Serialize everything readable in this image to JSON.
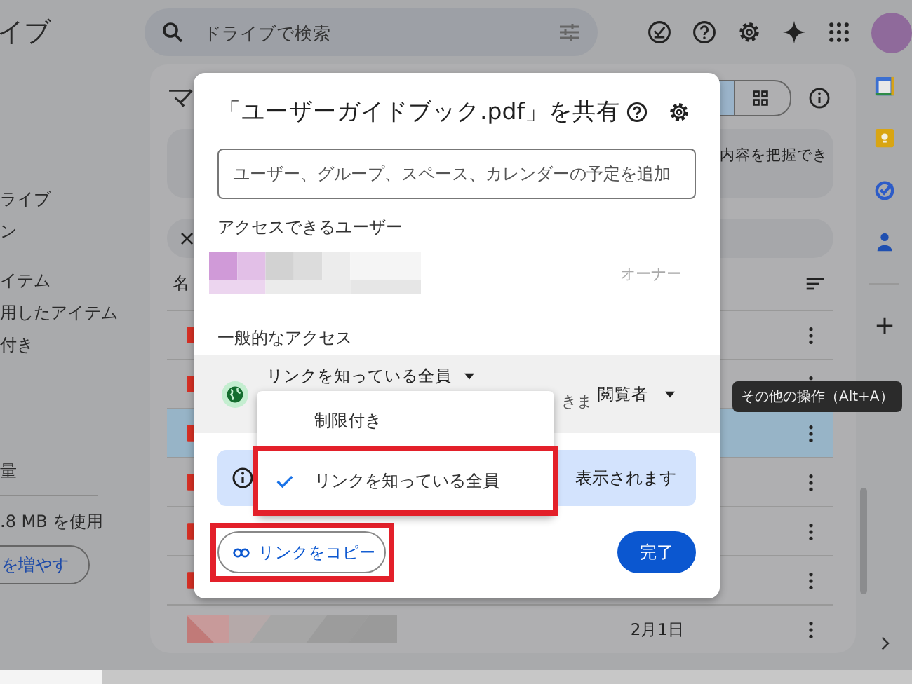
{
  "topbar": {
    "title": "イブ",
    "search": {
      "placeholder": "ドライブで検索"
    }
  },
  "sidebar": {
    "items": [
      {
        "label": "ライブ"
      },
      {
        "label": "ン"
      },
      {
        "label": "イテム"
      },
      {
        "label": "用したアイテム"
      },
      {
        "label": "付き"
      }
    ],
    "storage": {
      "title": "量",
      "usage": ".8 MB を使用",
      "button": "を増やす"
    }
  },
  "main": {
    "title": "マ",
    "notice": "内容を把握でき",
    "filter_chip": "×",
    "column_1": "名",
    "rows": [
      {
        "kind": "file",
        "selected": false
      },
      {
        "kind": "file",
        "selected": false
      },
      {
        "kind": "file",
        "selected": true
      },
      {
        "kind": "file",
        "selected": false
      },
      {
        "kind": "file",
        "selected": false
      },
      {
        "kind": "file",
        "selected": false
      },
      {
        "kind": "picture",
        "selected": false,
        "date": "2月1日"
      }
    ],
    "tooltip": "その他の操作（Alt+A）"
  },
  "dialog": {
    "title": "「ユーザーガイドブック.pdf」を共有",
    "add_people": {
      "placeholder": "ユーザー、グループ、スペース、カレンダーの予定を追加"
    },
    "people_heading": "アクセスできるユーザー",
    "people": [
      {
        "kind": "picture",
        "role": "オーナー"
      }
    ],
    "general_heading": "一般的なアクセス",
    "access": {
      "label": "リンクを知っている全員",
      "description": "きま",
      "role": "閲覧者"
    },
    "info": "表示されます",
    "menu": [
      {
        "label": "制限付き",
        "selected": false,
        "highlighted": false
      },
      {
        "label": "リンクを知っている全員",
        "selected": true,
        "highlighted": true
      }
    ],
    "copy_button": {
      "label": "リンクをコピー",
      "highlighted": true
    },
    "done_button": "完了"
  }
}
